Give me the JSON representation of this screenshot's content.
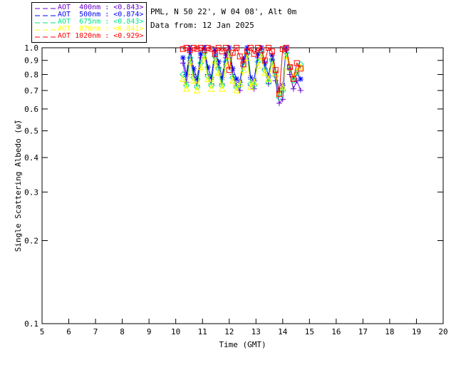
{
  "header": {
    "location": "PML, N 50 22', W 04 08', Alt 0m",
    "date_line": "Data from: 12 Jan 2025"
  },
  "chart_data": {
    "type": "line",
    "title": "",
    "xlabel": "Time (GMT)",
    "ylabel": "Single Scattering Albedo (ω̃)",
    "xlim": [
      5,
      20
    ],
    "ylim": [
      0.1,
      1.0
    ],
    "yscale": "log",
    "grid": false,
    "legend_position": "top-left-outside",
    "x_ticks": [
      5,
      6,
      7,
      8,
      9,
      10,
      11,
      12,
      13,
      14,
      15,
      16,
      17,
      18,
      19,
      20
    ],
    "y_ticks": [
      1.0,
      0.9,
      0.8,
      0.7,
      0.6,
      0.5,
      0.4,
      0.3,
      0.2,
      0.1
    ],
    "axis_color": "#000000",
    "x": [
      10.27,
      10.4,
      10.53,
      10.67,
      10.8,
      10.93,
      11.07,
      11.2,
      11.33,
      11.47,
      11.6,
      11.73,
      11.87,
      12.0,
      12.13,
      12.27,
      12.4,
      12.53,
      12.67,
      12.8,
      12.93,
      13.07,
      13.2,
      13.33,
      13.47,
      13.6,
      13.73,
      13.87,
      14.0,
      14.13,
      14.27,
      14.4,
      14.53,
      14.67
    ],
    "series": [
      {
        "name": "AOT 400nm",
        "legend_label": "AOT  400nm : <0.843>",
        "mean_value": "<0.843>",
        "color": "#6600cc",
        "marker": "plus",
        "values": [
          0.88,
          0.75,
          0.97,
          0.8,
          0.73,
          0.92,
          1.0,
          0.8,
          0.74,
          0.95,
          0.85,
          0.74,
          0.92,
          1.0,
          0.8,
          0.73,
          0.7,
          0.88,
          0.98,
          0.73,
          0.71,
          0.92,
          1.0,
          0.84,
          0.74,
          0.91,
          0.76,
          0.63,
          0.65,
          0.98,
          0.8,
          0.71,
          0.76,
          0.7
        ]
      },
      {
        "name": "AOT 500nm",
        "legend_label": "AOT  500nm : <0.874>",
        "mean_value": "<0.874>",
        "color": "#0000ff",
        "marker": "asterisk",
        "values": [
          0.92,
          0.8,
          1.0,
          0.84,
          0.77,
          0.95,
          1.0,
          0.85,
          0.78,
          0.98,
          0.89,
          0.78,
          0.95,
          1.0,
          0.84,
          0.77,
          0.75,
          0.91,
          1.0,
          0.78,
          0.76,
          0.95,
          1.0,
          0.88,
          0.79,
          0.94,
          0.81,
          0.7,
          0.73,
          1.0,
          0.85,
          0.77,
          0.81,
          0.77
        ]
      },
      {
        "name": "AOT 675nm",
        "legend_label": "AOT  675nm : <0.843>",
        "mean_value": "<0.843>",
        "color": "#00e687",
        "marker": "diamond",
        "values": [
          0.8,
          0.73,
          0.92,
          0.78,
          0.72,
          0.88,
          0.96,
          0.79,
          0.73,
          0.93,
          0.84,
          0.73,
          0.89,
          0.96,
          0.78,
          0.72,
          0.73,
          0.86,
          0.95,
          0.74,
          0.73,
          0.89,
          0.96,
          0.83,
          0.75,
          0.9,
          0.79,
          0.66,
          0.7,
          0.96,
          0.84,
          0.76,
          0.81,
          0.87
        ]
      },
      {
        "name": "AOT 870nm",
        "legend_label": "AOT  870nm : <0.841>",
        "mean_value": "<0.841>",
        "color": "#ffff00",
        "marker": "triangle",
        "values": [
          0.77,
          0.71,
          0.89,
          0.76,
          0.7,
          0.85,
          0.93,
          0.77,
          0.71,
          0.9,
          0.81,
          0.71,
          0.86,
          0.93,
          0.76,
          0.7,
          0.74,
          0.83,
          0.92,
          0.72,
          0.75,
          0.86,
          0.93,
          0.81,
          0.77,
          0.87,
          0.81,
          0.68,
          0.72,
          0.93,
          0.85,
          0.78,
          0.82,
          0.85
        ]
      },
      {
        "name": "AOT 1020nm",
        "legend_label": "AOT 1020nm : <0.929>",
        "mean_value": "<0.929>",
        "color": "#ff0000",
        "marker": "square",
        "values": [
          0.99,
          1.0,
          0.98,
          1.0,
          0.99,
          1.0,
          0.98,
          1.0,
          0.99,
          0.95,
          1.0,
          0.97,
          1.0,
          0.83,
          0.96,
          1.0,
          0.93,
          0.87,
          0.97,
          1.0,
          0.95,
          1.0,
          0.98,
          0.9,
          1.0,
          0.97,
          0.83,
          0.68,
          0.99,
          1.0,
          0.85,
          0.77,
          0.88,
          0.84
        ]
      }
    ]
  }
}
